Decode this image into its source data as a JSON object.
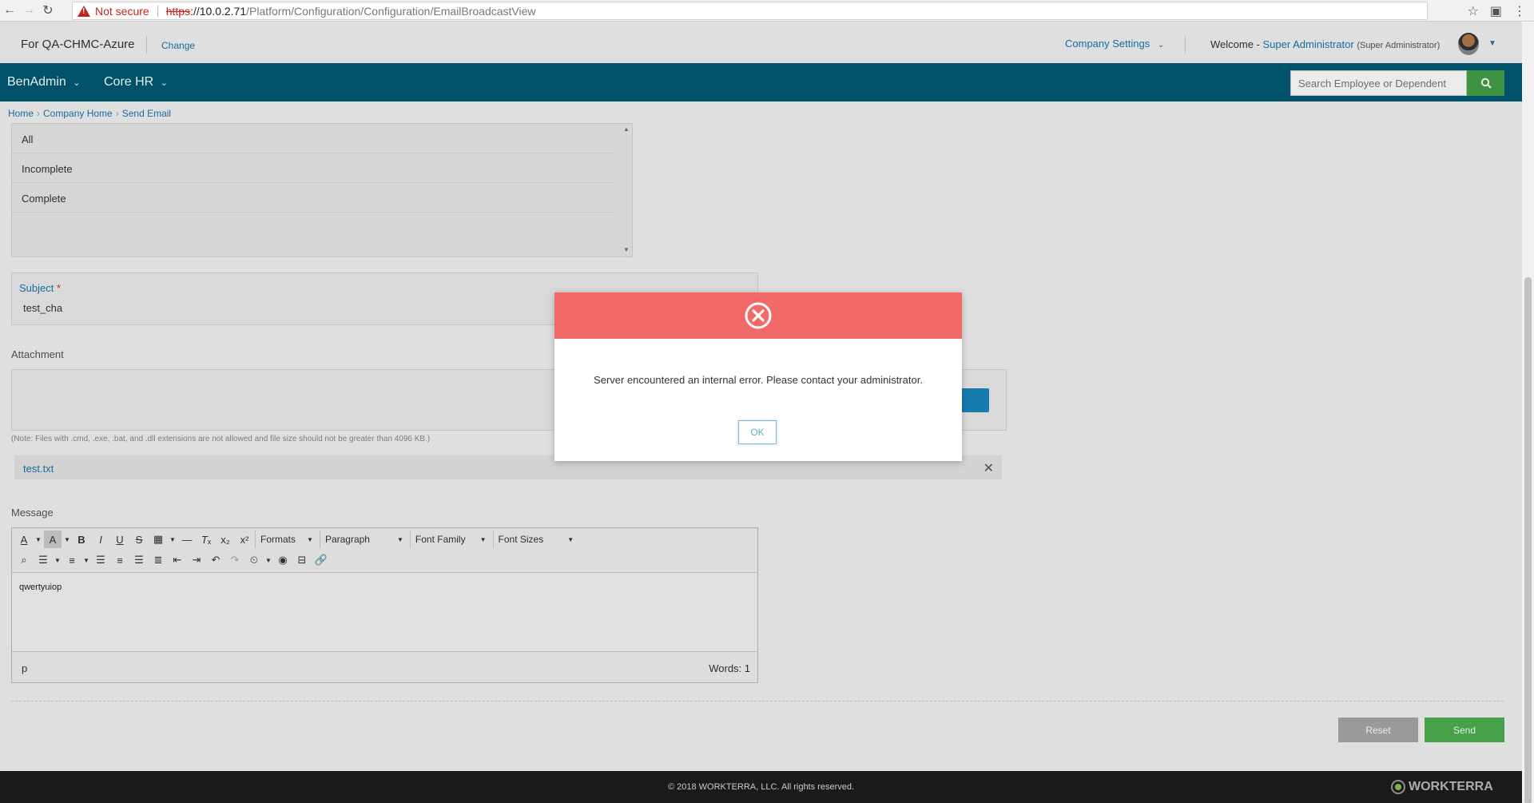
{
  "browser": {
    "security_text": "Not secure",
    "url_scheme": "https",
    "url_host": "://10.0.2.71",
    "url_path": "/Platform/Configuration/Configuration/EmailBroadcastView"
  },
  "header": {
    "company": "For QA-CHMC-Azure",
    "change_label": "Change",
    "company_settings": "Company Settings",
    "welcome_prefix": "Welcome -",
    "user_name": "Super Administrator",
    "user_role": "(Super Administrator)"
  },
  "nav": {
    "menus": [
      {
        "label": "BenAdmin"
      },
      {
        "label": "Core HR"
      }
    ],
    "search_placeholder": "Search Employee or Dependent"
  },
  "breadcrumb": [
    "Home",
    "Company Home",
    "Send Email"
  ],
  "status_list": [
    "All",
    "Incomplete",
    "Complete"
  ],
  "subject": {
    "label": "Subject",
    "required_mark": "*",
    "value": "test_cha"
  },
  "attachment": {
    "label": "Attachment",
    "note": "(Note: Files with .cmd, .exe, .bat, and .dll extensions are not allowed and file size should not be greater than 4096 KB.)",
    "file_name": "test.txt"
  },
  "message": {
    "label": "Message",
    "toolbar_dropdowns": [
      "Formats",
      "Paragraph",
      "Font Family",
      "Font Sizes"
    ],
    "body_text": "qwertyuiop",
    "status_path": "p",
    "word_count": "Words: 1"
  },
  "actions": {
    "reset_label": "Reset",
    "send_label": "Send"
  },
  "footer": {
    "copyright": "© 2018 WORKTERRA, LLC. All rights reserved.",
    "logo_text": "WORKTERRA"
  },
  "dialog": {
    "message": "Server encountered an internal error. Please contact your administrator.",
    "ok_label": "OK"
  },
  "colors": {
    "nav_bg": "#005a73",
    "link": "#1a76a9",
    "error_header": "#f26a67",
    "send_green": "#4caf50"
  }
}
